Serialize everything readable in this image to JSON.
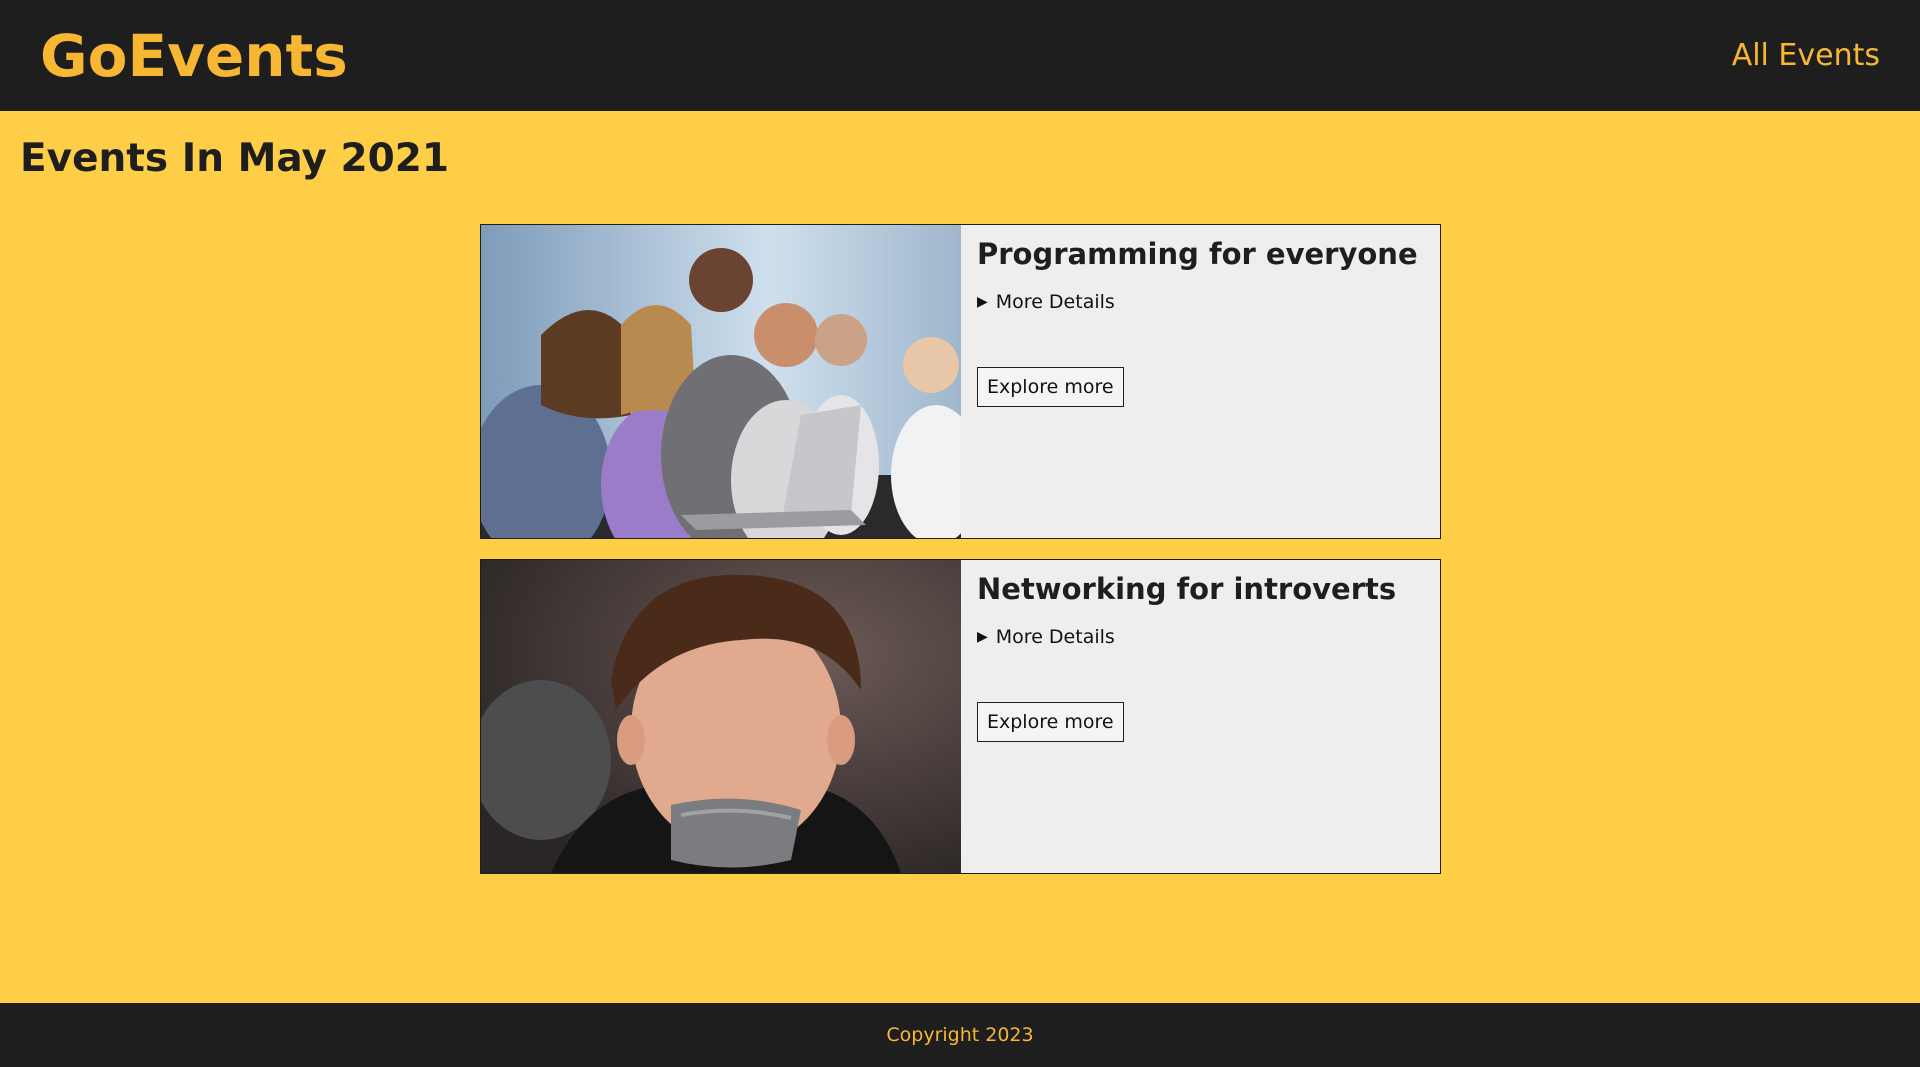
{
  "header": {
    "logo": "GoEvents",
    "nav_link": "All Events"
  },
  "main": {
    "title": "Events In May 2021"
  },
  "events": [
    {
      "title": "Programming for everyone",
      "details_label": "More Details",
      "button_label": "Explore more",
      "image_icon": "group-laptop-photo"
    },
    {
      "title": "Networking for introverts",
      "details_label": "More Details",
      "button_label": "Explore more",
      "image_icon": "taped-mouth-photo"
    }
  ],
  "footer": {
    "copyright": "Copyright 2023"
  },
  "colors": {
    "background": "#ffce47",
    "header_bg": "#1e1e1f",
    "accent": "#f7b733",
    "card_bg": "#eeeeee"
  }
}
